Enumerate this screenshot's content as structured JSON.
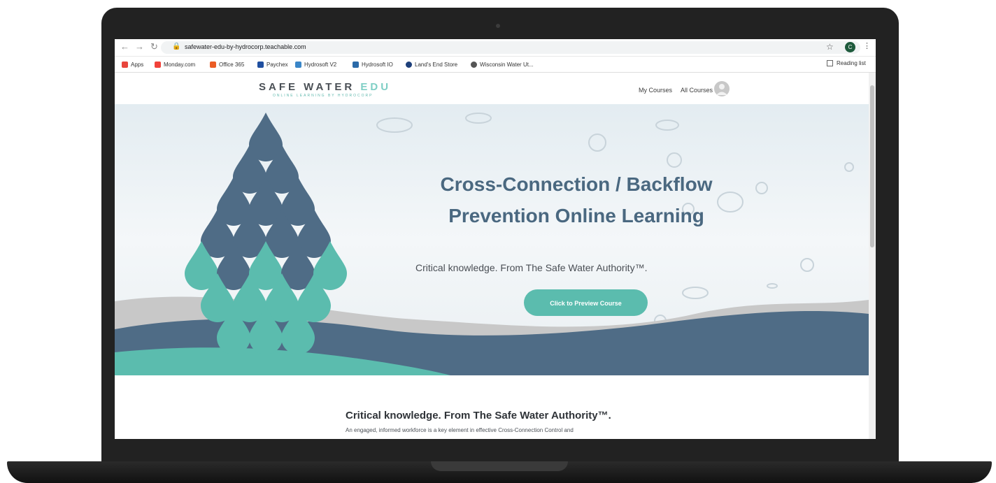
{
  "browser": {
    "url": "safewater-edu-by-hydrocorp.teachable.com",
    "profile_initial": "C",
    "bookmarks": [
      {
        "label": "Apps",
        "color": "#e8453c"
      },
      {
        "label": "Monday.com",
        "color": "#f1423a"
      },
      {
        "label": "Office 365",
        "color": "#eb5c24"
      },
      {
        "label": "Paychex",
        "color": "#1f4fa0"
      },
      {
        "label": "Hydrosoft V2",
        "color": "#3a86c8"
      },
      {
        "label": "Hydrosoft IO",
        "color": "#2b6aa8"
      },
      {
        "label": "Land's End Store",
        "color": "#1d3f7a"
      },
      {
        "label": "Wisconsin Water Ut...",
        "color": "#555555"
      }
    ],
    "reading_list": "Reading list"
  },
  "site": {
    "logo_main": "SAFE WATER",
    "logo_edu": "EDU",
    "logo_tagline": "ONLINE LEARNING BY HYDROCORP",
    "nav": [
      "My Courses",
      "All Courses"
    ]
  },
  "hero": {
    "title_line1": "Cross-Connection / Backflow",
    "title_line2": "Prevention Online Learning",
    "subtitle": "Critical knowledge. From The Safe Water Authority™.",
    "cta_label": "Click to Preview Course"
  },
  "section": {
    "title": "Critical knowledge. From The Safe Water Authority™.",
    "body": "An engaged, informed workforce is a key element in effective Cross-Connection Control and"
  },
  "colors": {
    "accent_teal": "#5bbcae",
    "dark_slate": "#4a6880",
    "bezel": "#222222"
  }
}
